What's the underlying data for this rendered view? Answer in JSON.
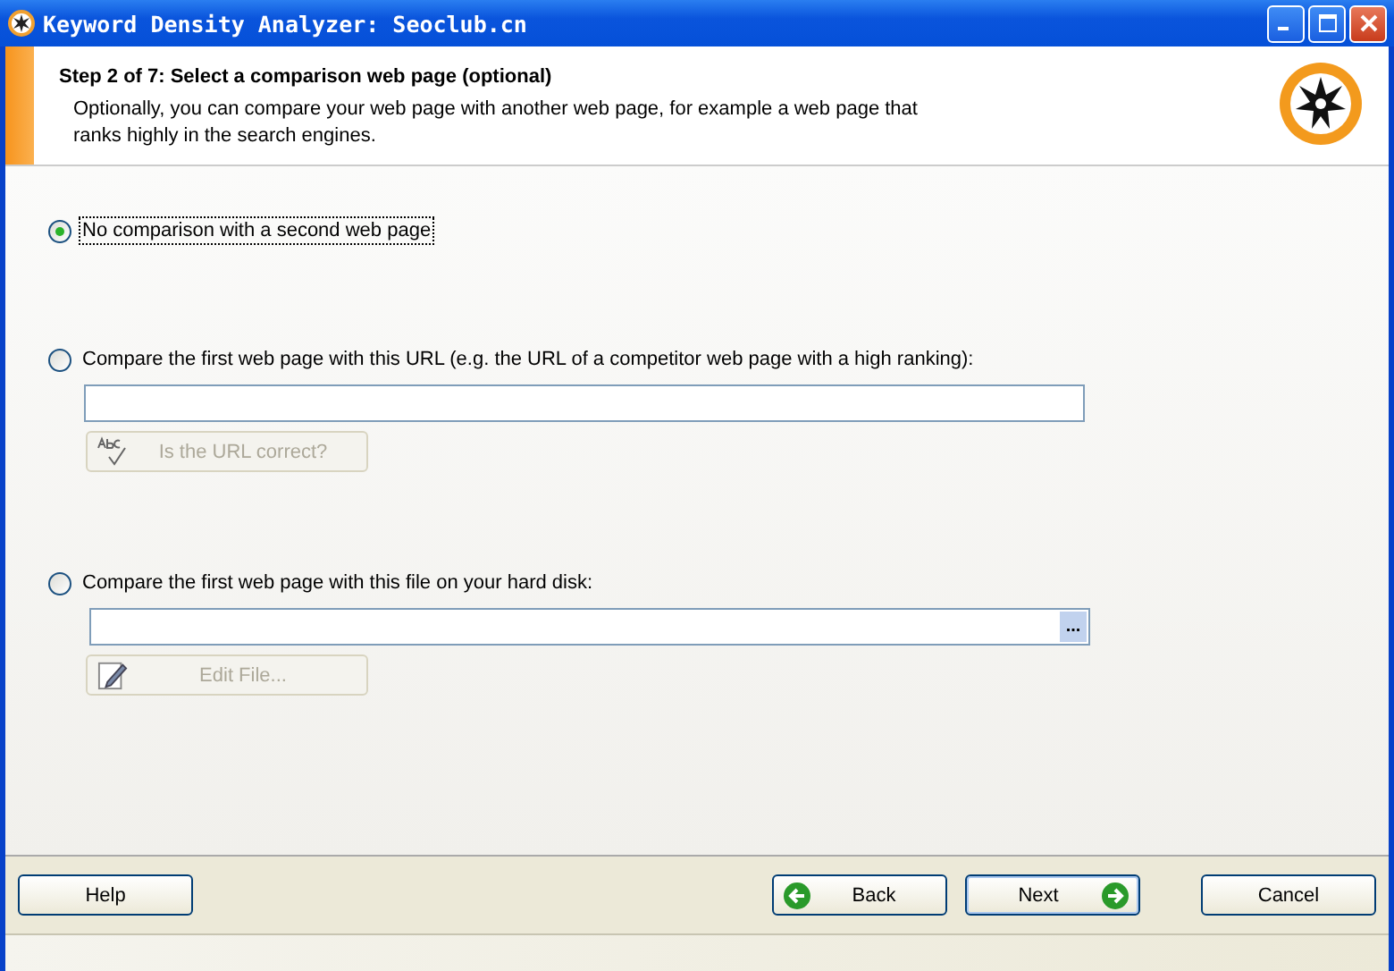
{
  "window": {
    "title": "Keyword Density Analyzer: Seoclub.cn"
  },
  "header": {
    "step": "Step 2 of 7: Select a comparison web page (optional)",
    "description": "Optionally, you can compare your web page with another web page, for example a web page that ranks highly in the search engines."
  },
  "options": [
    {
      "label": "No comparison with a second web page",
      "selected": true
    },
    {
      "label": "Compare the first web page with this URL (e.g. the URL of a competitor web page with a high ranking):",
      "selected": false,
      "field": {
        "kind": "text"
      },
      "button": {
        "label": "Is the URL correct?",
        "kind": "spellcheck",
        "disabled": true
      }
    },
    {
      "label": "Compare the first web page with this file on your hard disk:",
      "selected": false,
      "field": {
        "kind": "browse",
        "browse_label": "..."
      },
      "button": {
        "label": "Edit File...",
        "kind": "edit",
        "disabled": true
      }
    }
  ],
  "footer": {
    "help": "Help",
    "back": "Back",
    "next": "Next",
    "cancel": "Cancel"
  }
}
